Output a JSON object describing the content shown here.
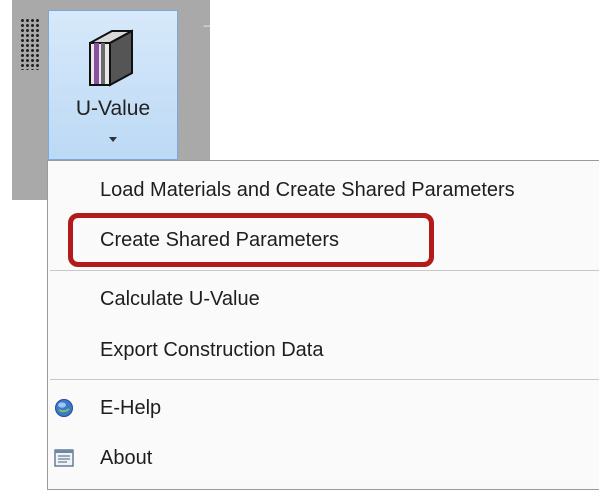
{
  "ribbon": {
    "button_label": "U-Value",
    "button_icon": "wall-layers-icon",
    "expander_glyph": "–"
  },
  "menu": {
    "items": [
      {
        "label": "Load Materials and Create Shared Parameters"
      },
      {
        "label": "Create Shared Parameters",
        "highlighted": true
      },
      {
        "label": "Calculate U-Value"
      },
      {
        "label": "Export Construction Data"
      },
      {
        "label": "E-Help",
        "icon": "help-globe-icon"
      },
      {
        "label": "About",
        "icon": "about-window-icon"
      }
    ]
  },
  "colors": {
    "highlight_border": "#b31b1b",
    "ribbon_button_bg": "#c9e1f8",
    "toolbar_bg": "#a9a9a9"
  }
}
